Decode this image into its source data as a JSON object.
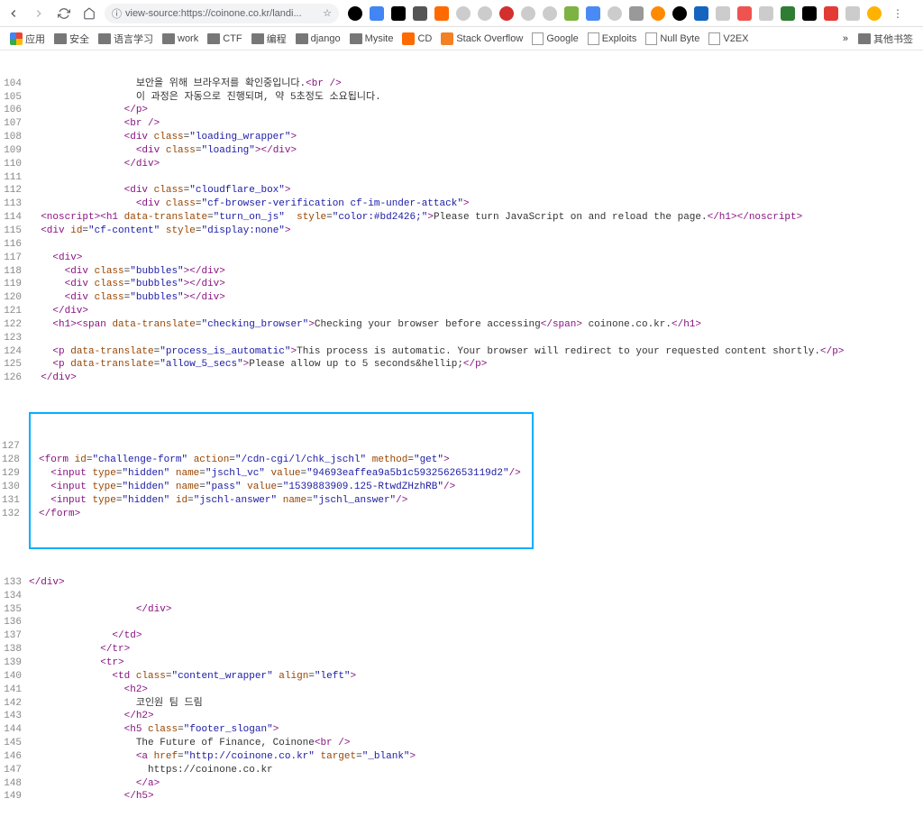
{
  "toolbar": {
    "url": "view-source:https://coinone.co.kr/landi..."
  },
  "bookmarks": {
    "apps": "应用",
    "items": [
      "安全",
      "语言学习",
      "work",
      "CTF",
      "编程",
      "django",
      "Mysite",
      "CD",
      "Stack Overflow",
      "Google",
      "Exploits",
      "Null Byte",
      "V2EX"
    ],
    "other": "其他书签"
  },
  "ext_icons": [
    {
      "bg": "#000",
      "r": "50%"
    },
    {
      "bg": "#4285f4"
    },
    {
      "bg": "#000"
    },
    {
      "bg": "#555"
    },
    {
      "bg": "#ff6a00"
    },
    {
      "bg": "#ccc",
      "r": "50%"
    },
    {
      "bg": "#ccc",
      "r": "50%"
    },
    {
      "bg": "#d32f2f",
      "r": "50%"
    },
    {
      "bg": "#ccc",
      "r": "50%"
    },
    {
      "bg": "#ccc",
      "r": "50%"
    },
    {
      "bg": "#7cb342"
    },
    {
      "bg": "#4a8af4"
    },
    {
      "bg": "#ccc",
      "r": "50%"
    },
    {
      "bg": "#999"
    },
    {
      "bg": "#ff8a00",
      "r": "50%"
    },
    {
      "bg": "#000",
      "r": "50%"
    },
    {
      "bg": "#1565c0"
    },
    {
      "bg": "#ccc"
    },
    {
      "bg": "#ef5350"
    },
    {
      "bg": "#ccc"
    },
    {
      "bg": "#2e7d32"
    },
    {
      "bg": "#000"
    },
    {
      "bg": "#e53935"
    },
    {
      "bg": "#ccc"
    },
    {
      "bg": "#ffb300",
      "r": "50%"
    }
  ],
  "source_lines": [
    {
      "n": 104,
      "i": 18,
      "html": "보안을 위해 브라우저를 확인중입니다.<span class='tag'>&lt;br /&gt;</span>"
    },
    {
      "n": 105,
      "i": 18,
      "html": "이 과정은 자동으로 진행되며, 약 5초정도 소요됩니다."
    },
    {
      "n": 106,
      "i": 16,
      "html": "<span class='tag'>&lt;/p&gt;</span>"
    },
    {
      "n": 107,
      "i": 16,
      "html": "<span class='tag'>&lt;br /&gt;</span>"
    },
    {
      "n": 108,
      "i": 16,
      "html": "<span class='tag'>&lt;div</span> <span class='attr'>class</span>=<span class='val'>\"loading_wrapper\"</span><span class='tag'>&gt;</span>"
    },
    {
      "n": 109,
      "i": 18,
      "html": "<span class='tag'>&lt;div</span> <span class='attr'>class</span>=<span class='val'>\"loading\"</span><span class='tag'>&gt;&lt;/div&gt;</span>"
    },
    {
      "n": 110,
      "i": 16,
      "html": "<span class='tag'>&lt;/div&gt;</span>"
    },
    {
      "n": 111,
      "i": 0,
      "html": ""
    },
    {
      "n": 112,
      "i": 16,
      "html": "<span class='tag'>&lt;div</span> <span class='attr'>class</span>=<span class='val'>\"cloudflare_box\"</span><span class='tag'>&gt;</span>"
    },
    {
      "n": 113,
      "i": 18,
      "html": "<span class='tag'>&lt;div</span> <span class='attr'>class</span>=<span class='val'>\"cf-browser-verification cf-im-under-attack\"</span><span class='tag'>&gt;</span>"
    },
    {
      "n": 114,
      "i": 2,
      "html": "<span class='tag'>&lt;noscript&gt;&lt;h1</span> <span class='attr'>data-translate</span>=<span class='val'>\"turn_on_js\"</span>  <span class='attr'>style</span>=<span class='val'>\"color:#bd2426;\"</span><span class='tag'>&gt;</span>Please turn JavaScript on and reload the page.<span class='tag'>&lt;/h1&gt;&lt;/noscript&gt;</span>"
    },
    {
      "n": 115,
      "i": 2,
      "html": "<span class='tag'>&lt;div</span> <span class='attr'>id</span>=<span class='val'>\"cf-content\"</span> <span class='attr'>style</span>=<span class='val'>\"display:none\"</span><span class='tag'>&gt;</span>"
    },
    {
      "n": 116,
      "i": 0,
      "html": ""
    },
    {
      "n": 117,
      "i": 4,
      "html": "<span class='tag'>&lt;div&gt;</span>"
    },
    {
      "n": 118,
      "i": 6,
      "html": "<span class='tag'>&lt;div</span> <span class='attr'>class</span>=<span class='val'>\"bubbles\"</span><span class='tag'>&gt;&lt;/div&gt;</span>"
    },
    {
      "n": 119,
      "i": 6,
      "html": "<span class='tag'>&lt;div</span> <span class='attr'>class</span>=<span class='val'>\"bubbles\"</span><span class='tag'>&gt;&lt;/div&gt;</span>"
    },
    {
      "n": 120,
      "i": 6,
      "html": "<span class='tag'>&lt;div</span> <span class='attr'>class</span>=<span class='val'>\"bubbles\"</span><span class='tag'>&gt;&lt;/div&gt;</span>"
    },
    {
      "n": 121,
      "i": 4,
      "html": "<span class='tag'>&lt;/div&gt;</span>"
    },
    {
      "n": 122,
      "i": 4,
      "html": "<span class='tag'>&lt;h1&gt;&lt;span</span> <span class='attr'>data-translate</span>=<span class='val'>\"checking_browser\"</span><span class='tag'>&gt;</span>Checking your browser before accessing<span class='tag'>&lt;/span&gt;</span> coinone.co.kr.<span class='tag'>&lt;/h1&gt;</span>"
    },
    {
      "n": 123,
      "i": 0,
      "html": ""
    },
    {
      "n": 124,
      "i": 4,
      "html": "<span class='tag'>&lt;p</span> <span class='attr'>data-translate</span>=<span class='val'>\"process_is_automatic\"</span><span class='tag'>&gt;</span>This process is automatic. Your browser will redirect to your requested content shortly.<span class='tag'>&lt;/p&gt;</span>"
    },
    {
      "n": 125,
      "i": 4,
      "html": "<span class='tag'>&lt;p</span> <span class='attr'>data-translate</span>=<span class='val'>\"allow_5_secs\"</span><span class='tag'>&gt;</span>Please allow up to 5 seconds&amp;hellip;<span class='tag'>&lt;/p&gt;</span>"
    },
    {
      "n": 126,
      "i": 2,
      "html": "<span class='tag'>&lt;/div&gt;</span>"
    }
  ],
  "highlight_lines": [
    {
      "n": 127,
      "i": 0,
      "html": ""
    },
    {
      "n": 128,
      "i": 2,
      "html": "<span class='tag'>&lt;form</span> <span class='attr'>id</span>=<span class='val'>\"challenge-form\"</span> <span class='attr'>action</span>=<span class='val'>\"/cdn-cgi/l/chk_jschl\"</span> <span class='attr'>method</span>=<span class='val'>\"get\"</span><span class='tag'>&gt;</span>"
    },
    {
      "n": 129,
      "i": 4,
      "html": "<span class='tag'>&lt;input</span> <span class='attr'>type</span>=<span class='val'>\"hidden\"</span> <span class='attr'>name</span>=<span class='val'>\"jschl_vc\"</span> <span class='attr'>value</span>=<span class='val'>\"94693eaffea9a5b1c5932562653119d2\"</span><span class='tag'>/&gt;</span>"
    },
    {
      "n": 130,
      "i": 4,
      "html": "<span class='tag'>&lt;input</span> <span class='attr'>type</span>=<span class='val'>\"hidden\"</span> <span class='attr'>name</span>=<span class='val'>\"pass\"</span> <span class='attr'>value</span>=<span class='val'>\"1539883909.125-RtwdZHzhRB\"</span><span class='tag'>/&gt;</span>"
    },
    {
      "n": 131,
      "i": 4,
      "html": "<span class='tag'>&lt;input</span> <span class='attr'>type</span>=<span class='val'>\"hidden\"</span> <span class='attr'>id</span>=<span class='val'>\"jschl-answer\"</span> <span class='attr'>name</span>=<span class='val'>\"jschl_answer\"</span><span class='tag'>/&gt;</span>"
    },
    {
      "n": 132,
      "i": 2,
      "html": "<span class='tag'>&lt;/form&gt;</span>"
    }
  ],
  "source_lines_after": [
    {
      "n": 133,
      "i": 0,
      "html": "<span class='tag'>&lt;/div&gt;</span>"
    },
    {
      "n": 134,
      "i": 0,
      "html": ""
    },
    {
      "n": 135,
      "i": 18,
      "html": "<span class='tag'>&lt;/div&gt;</span>"
    },
    {
      "n": 136,
      "i": 0,
      "html": ""
    },
    {
      "n": 137,
      "i": 14,
      "html": "<span class='tag'>&lt;/td&gt;</span>"
    },
    {
      "n": 138,
      "i": 12,
      "html": "<span class='tag'>&lt;/tr&gt;</span>"
    },
    {
      "n": 139,
      "i": 12,
      "html": "<span class='tag'>&lt;tr&gt;</span>"
    },
    {
      "n": 140,
      "i": 14,
      "html": "<span class='tag'>&lt;td</span> <span class='attr'>class</span>=<span class='val'>\"content_wrapper\"</span> <span class='attr'>align</span>=<span class='val'>\"left\"</span><span class='tag'>&gt;</span>"
    },
    {
      "n": 141,
      "i": 16,
      "html": "<span class='tag'>&lt;h2&gt;</span>"
    },
    {
      "n": 142,
      "i": 18,
      "html": "코인원 팀 드림"
    },
    {
      "n": 143,
      "i": 16,
      "html": "<span class='tag'>&lt;/h2&gt;</span>"
    },
    {
      "n": 144,
      "i": 16,
      "html": "<span class='tag'>&lt;h5</span> <span class='attr'>class</span>=<span class='val'>\"footer_slogan\"</span><span class='tag'>&gt;</span>"
    },
    {
      "n": 145,
      "i": 18,
      "html": "The Future of Finance, Coinone<span class='tag'>&lt;br /&gt;</span>"
    },
    {
      "n": 146,
      "i": 18,
      "html": "<span class='tag'>&lt;a</span> <span class='attr'>href</span>=<span class='val'>\"http://coinone.co.kr\"</span> <span class='attr'>target</span>=<span class='val'>\"_blank\"</span><span class='tag'>&gt;</span>"
    },
    {
      "n": 147,
      "i": 20,
      "html": "https://coinone.co.kr"
    },
    {
      "n": 148,
      "i": 18,
      "html": "<span class='tag'>&lt;/a&gt;</span>"
    },
    {
      "n": 149,
      "i": 16,
      "html": "<span class='tag'>&lt;/h5&gt;</span>"
    }
  ]
}
